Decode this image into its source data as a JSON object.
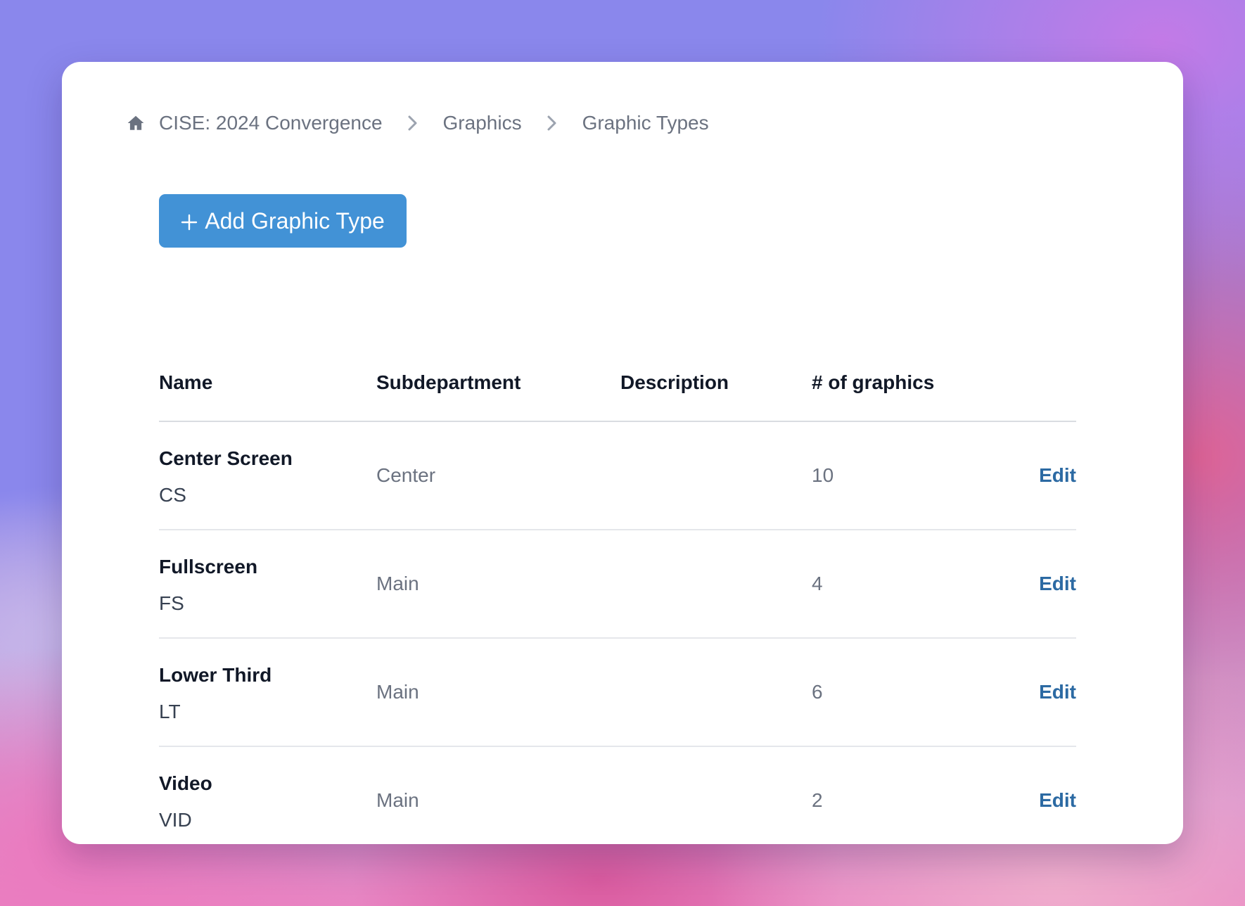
{
  "breadcrumb": {
    "home_icon": "home-icon",
    "items": [
      "CISE: 2024 Convergence",
      "Graphics",
      "Graphic Types"
    ]
  },
  "actions": {
    "add_label": "Add Graphic Type",
    "add_icon": "plus-icon"
  },
  "table": {
    "headers": {
      "name": "Name",
      "subdepartment": "Subdepartment",
      "description": "Description",
      "count": "# of graphics"
    },
    "rows": [
      {
        "name": "Center Screen",
        "code": "CS",
        "subdepartment": "Center",
        "description": "",
        "count": "10",
        "action": "Edit"
      },
      {
        "name": "Fullscreen",
        "code": "FS",
        "subdepartment": "Main",
        "description": "",
        "count": "4",
        "action": "Edit"
      },
      {
        "name": "Lower Third",
        "code": "LT",
        "subdepartment": "Main",
        "description": "",
        "count": "6",
        "action": "Edit"
      },
      {
        "name": "Video",
        "code": "VID",
        "subdepartment": "Main",
        "description": "",
        "count": "2",
        "action": "Edit"
      }
    ]
  },
  "colors": {
    "primary_button": "#4292d6",
    "link": "#2c6aa3",
    "muted_text": "#6b7280"
  }
}
